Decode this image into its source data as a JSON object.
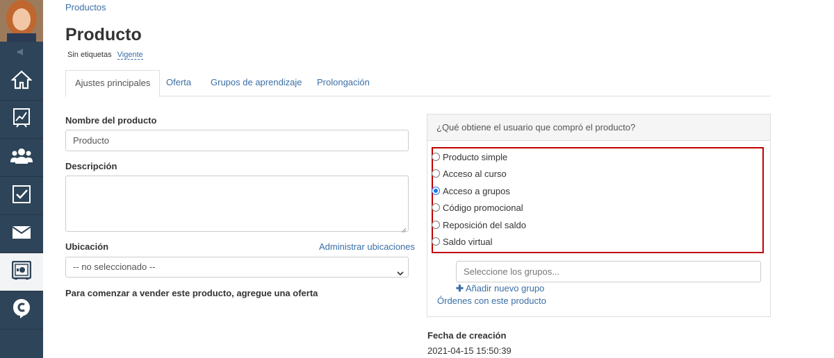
{
  "breadcrumb": "Productos",
  "page_title": "Producto",
  "tags": {
    "label": "Sin etiquetas",
    "status": "Vigente"
  },
  "tabs": [
    {
      "label": "Ajustes principales"
    },
    {
      "label": "Oferta"
    },
    {
      "label": "Grupos de aprendizaje"
    },
    {
      "label": "Prolongación"
    }
  ],
  "form": {
    "name_label": "Nombre del producto",
    "name_value": "Producto",
    "description_label": "Descripción",
    "description_value": "",
    "location_label": "Ubicación",
    "manage_locations_link": "Administrar ubicaciones",
    "location_selected": "-- no seleccionado --",
    "sell_hint": "Para comenzar a vender este producto, agregue una oferta"
  },
  "panel": {
    "question": "¿Qué obtiene el usuario que compró el producto?",
    "options": [
      {
        "label": "Producto simple",
        "checked": false
      },
      {
        "label": "Acceso al curso",
        "checked": false
      },
      {
        "label": "Acceso a grupos",
        "checked": true
      },
      {
        "label": "Código promocional",
        "checked": false
      },
      {
        "label": "Reposición del saldo",
        "checked": false
      },
      {
        "label": "Saldo virtual",
        "checked": false
      }
    ],
    "groups_placeholder": "Seleccione los grupos...",
    "add_group_link": "Añadir nuevo grupo",
    "orders_link": "Órdenes con este producto"
  },
  "created": {
    "label": "Fecha de creación",
    "value": "2021-04-15 15:50:39"
  },
  "colors": {
    "sidebar": "#2e4458",
    "link": "#3a6ea5",
    "highlight_box": "#c00000",
    "radio_selected": "#1a73e8"
  }
}
